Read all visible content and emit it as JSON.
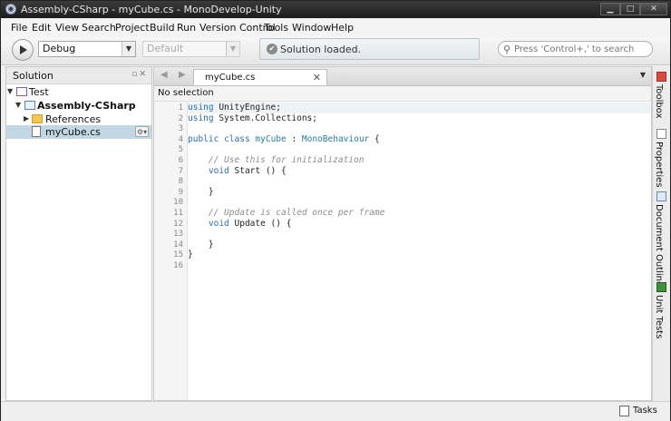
{
  "window": {
    "title": "Assembly-CSharp - myCube.cs - MonoDevelop-Unity",
    "controls": {
      "minimize": "▁",
      "maximize": "□",
      "close": "✕"
    }
  },
  "menu": [
    "File",
    "Edit",
    "View",
    "Search",
    "Project",
    "Build",
    "Run",
    "Version Control",
    "Tools",
    "Window",
    "Help"
  ],
  "toolbar": {
    "config_value": "Debug",
    "platform_value": "Default",
    "status": "Solution loaded.",
    "search_placeholder": "Press 'Control+,' to search"
  },
  "solution": {
    "title": "Solution",
    "tree": [
      {
        "label": "Test",
        "level": 0,
        "expanded": true,
        "bold": false,
        "icon": "solution-icon"
      },
      {
        "label": "Assembly-CSharp",
        "level": 1,
        "expanded": true,
        "bold": true,
        "icon": "project-icon"
      },
      {
        "label": "References",
        "level": 2,
        "expanded": false,
        "bold": false,
        "icon": "folder-icon"
      },
      {
        "label": "myCube.cs",
        "level": 2,
        "selected": true,
        "bold": false,
        "icon": "file-icon"
      }
    ]
  },
  "editor": {
    "tab": "myCube.cs",
    "breadcrumb": "No selection",
    "code": [
      "using UnityEngine;",
      "using System.Collections;",
      "",
      "public class myCube : MonoBehaviour {",
      "",
      "    // Use this for initialization",
      "    void Start () {",
      "",
      "    }",
      "",
      "    // Update is called once per frame",
      "    void Update () {",
      "",
      "    }",
      "}",
      ""
    ]
  },
  "dock": [
    "Toolbox",
    "Properties",
    "Document Outline",
    "Unit Tests"
  ],
  "statusbar": {
    "tasks": "Tasks"
  },
  "colors": {
    "selection": "#c3d6e3",
    "keyword": "#2f6fa7",
    "comment": "#8c8c8c",
    "type": "#2e7c9a"
  }
}
